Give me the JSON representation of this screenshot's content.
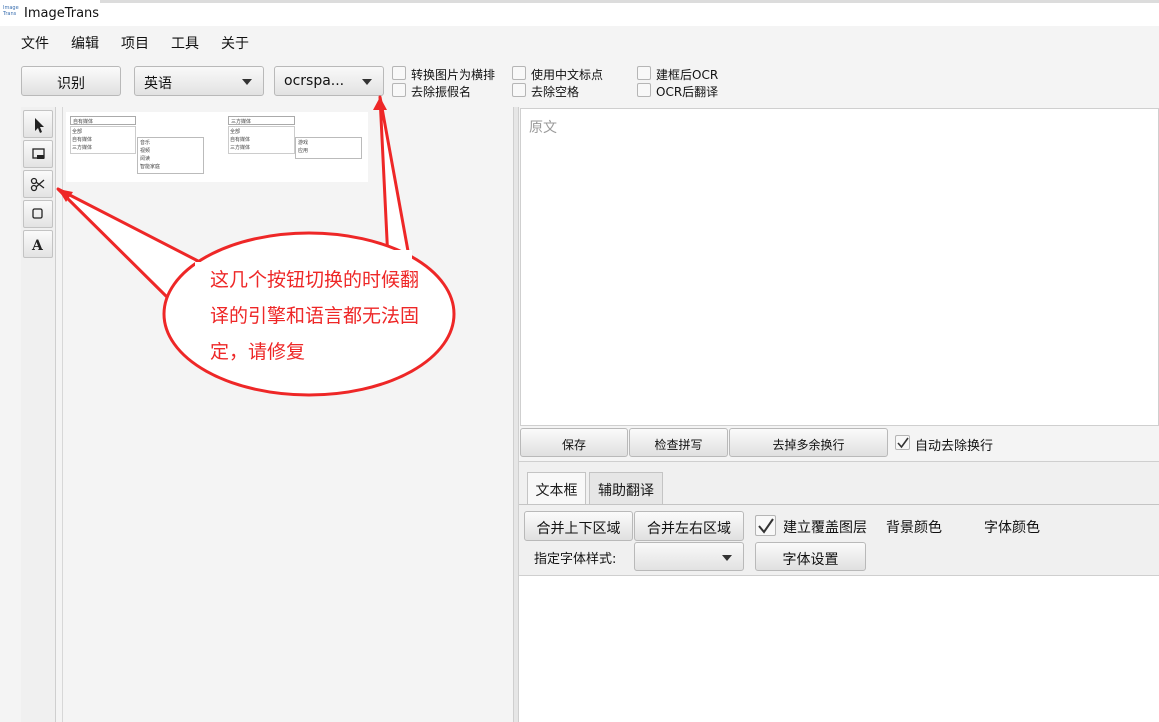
{
  "window": {
    "title": "ImageTrans",
    "logo_text": "Image Trans"
  },
  "menu": {
    "items": [
      "文件",
      "编辑",
      "项目",
      "工具",
      "关于"
    ]
  },
  "toolbar": {
    "recognize_label": "识别",
    "language_value": "英语",
    "engine_value": "ocrspa...",
    "options": {
      "convert_horizontal": "转换图片为横排",
      "remove_furigana": "去除振假名",
      "use_cn_punct": "使用中文标点",
      "remove_spaces": "去除空格",
      "ocr_after_box": "建框后OCR",
      "translate_after_ocr": "OCR后翻译"
    }
  },
  "tools": [
    "pointer-icon",
    "region-icon",
    "scissors-icon",
    "rectangle-icon",
    "text-icon"
  ],
  "thumbnail": {
    "left_dropdown": "自有媒体",
    "left_items": [
      "全部",
      "自有媒体",
      "三方媒体"
    ],
    "left_subitems": [
      "音乐",
      "视频",
      "阅读",
      "智能家庭"
    ],
    "right_dropdown": "三方媒体",
    "right_items": [
      "全部",
      "自有媒体",
      "三方媒体"
    ],
    "right_subitems": [
      "游戏",
      "应用"
    ]
  },
  "source": {
    "placeholder": "原文"
  },
  "actions": {
    "save": "保存",
    "spellcheck": "检查拼写",
    "remove_newlines": "去掉多余换行",
    "auto_remove_newlines": "自动去除换行",
    "auto_remove_checked": true
  },
  "tabs": {
    "textbox": "文本框",
    "assist": "辅助翻译"
  },
  "textbox_panel": {
    "merge_vertical": "合并上下区域",
    "merge_horizontal": "合并左右区域",
    "create_overlay": "建立覆盖图层",
    "create_overlay_checked": true,
    "bg_color": "背景颜色",
    "font_color": "字体颜色",
    "font_style_label": "指定字体样式:",
    "font_settings": "字体设置"
  },
  "annotation": {
    "text": "这几个按钮切换的时候翻译的引擎和语言都无法固定，请修复",
    "color": "#ee2727"
  },
  "colors": {
    "accent_red": "#ee2727",
    "panel_bg": "#f4f4f4"
  }
}
